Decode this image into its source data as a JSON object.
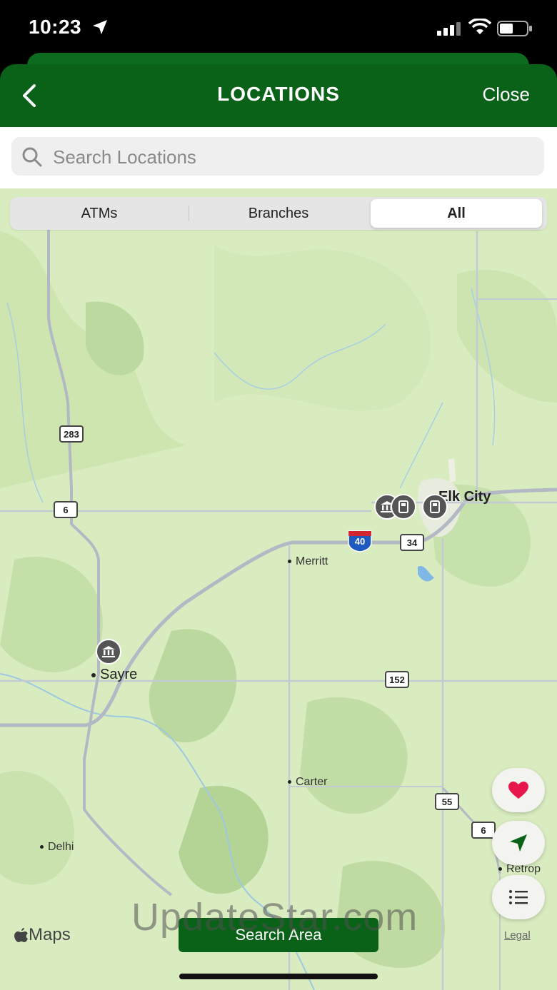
{
  "status_bar": {
    "time": "10:23"
  },
  "header": {
    "title": "LOCATIONS",
    "close_label": "Close"
  },
  "search": {
    "placeholder": "Search Locations",
    "value": ""
  },
  "segments": {
    "items": [
      "ATMs",
      "Branches",
      "All"
    ],
    "selected": "All"
  },
  "map": {
    "towns": {
      "elk_city": "Elk City",
      "sayre": "Sayre",
      "merritt": "Merritt",
      "carter": "Carter",
      "delhi": "Delhi",
      "retrop": "Retrop"
    },
    "routes": {
      "us283": "283",
      "ok6_west": "6",
      "i40": "40",
      "ok34": "34",
      "ok152": "152",
      "ok55": "55",
      "ok6_east": "6"
    },
    "attribution": "Maps",
    "legal": "Legal"
  },
  "actions": {
    "search_area": "Search Area",
    "favorites_icon": "heart-icon",
    "locate_icon": "location-arrow-icon",
    "list_icon": "list-icon"
  },
  "colors": {
    "brand_green": "#0a6219",
    "heart": "#e8174b"
  },
  "watermark": "UpdateStar.com"
}
